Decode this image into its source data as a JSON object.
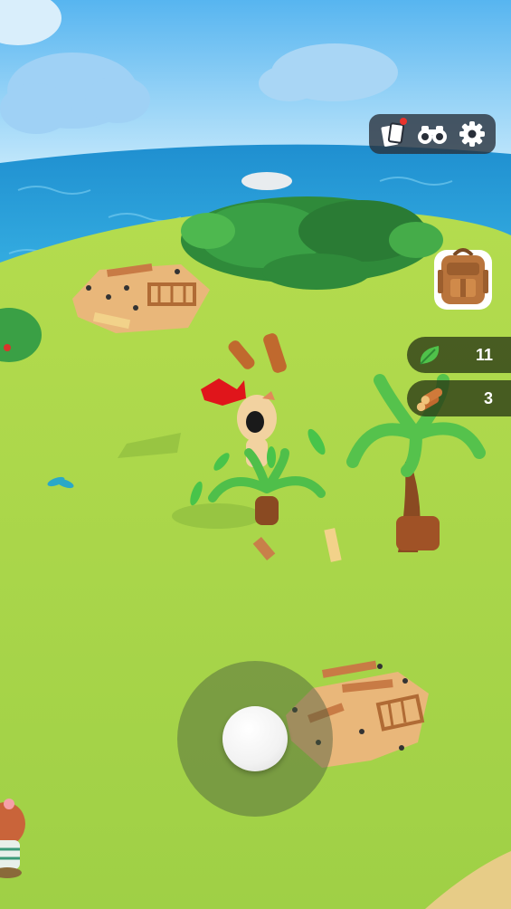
{
  "toolbar": {
    "cards_icon": "cards-icon",
    "binoculars_icon": "binoculars-icon",
    "settings_icon": "gear-icon",
    "notification_color": "#e8332c"
  },
  "backpack": {
    "icon": "backpack-icon"
  },
  "resources": [
    {
      "name": "leaves",
      "icon": "leaf-icon",
      "count": "11"
    },
    {
      "name": "wood",
      "icon": "wood-logs-icon",
      "count": "3"
    }
  ],
  "joystick": {
    "icon": "joystick-knob"
  },
  "colors": {
    "sky": "#7cc8f5",
    "ocean": "#1e9ad6",
    "grass": "#a6d94a",
    "sand": "#e9b77a",
    "hud_dark": "#282e38",
    "resource_pill": "#2a3816"
  }
}
